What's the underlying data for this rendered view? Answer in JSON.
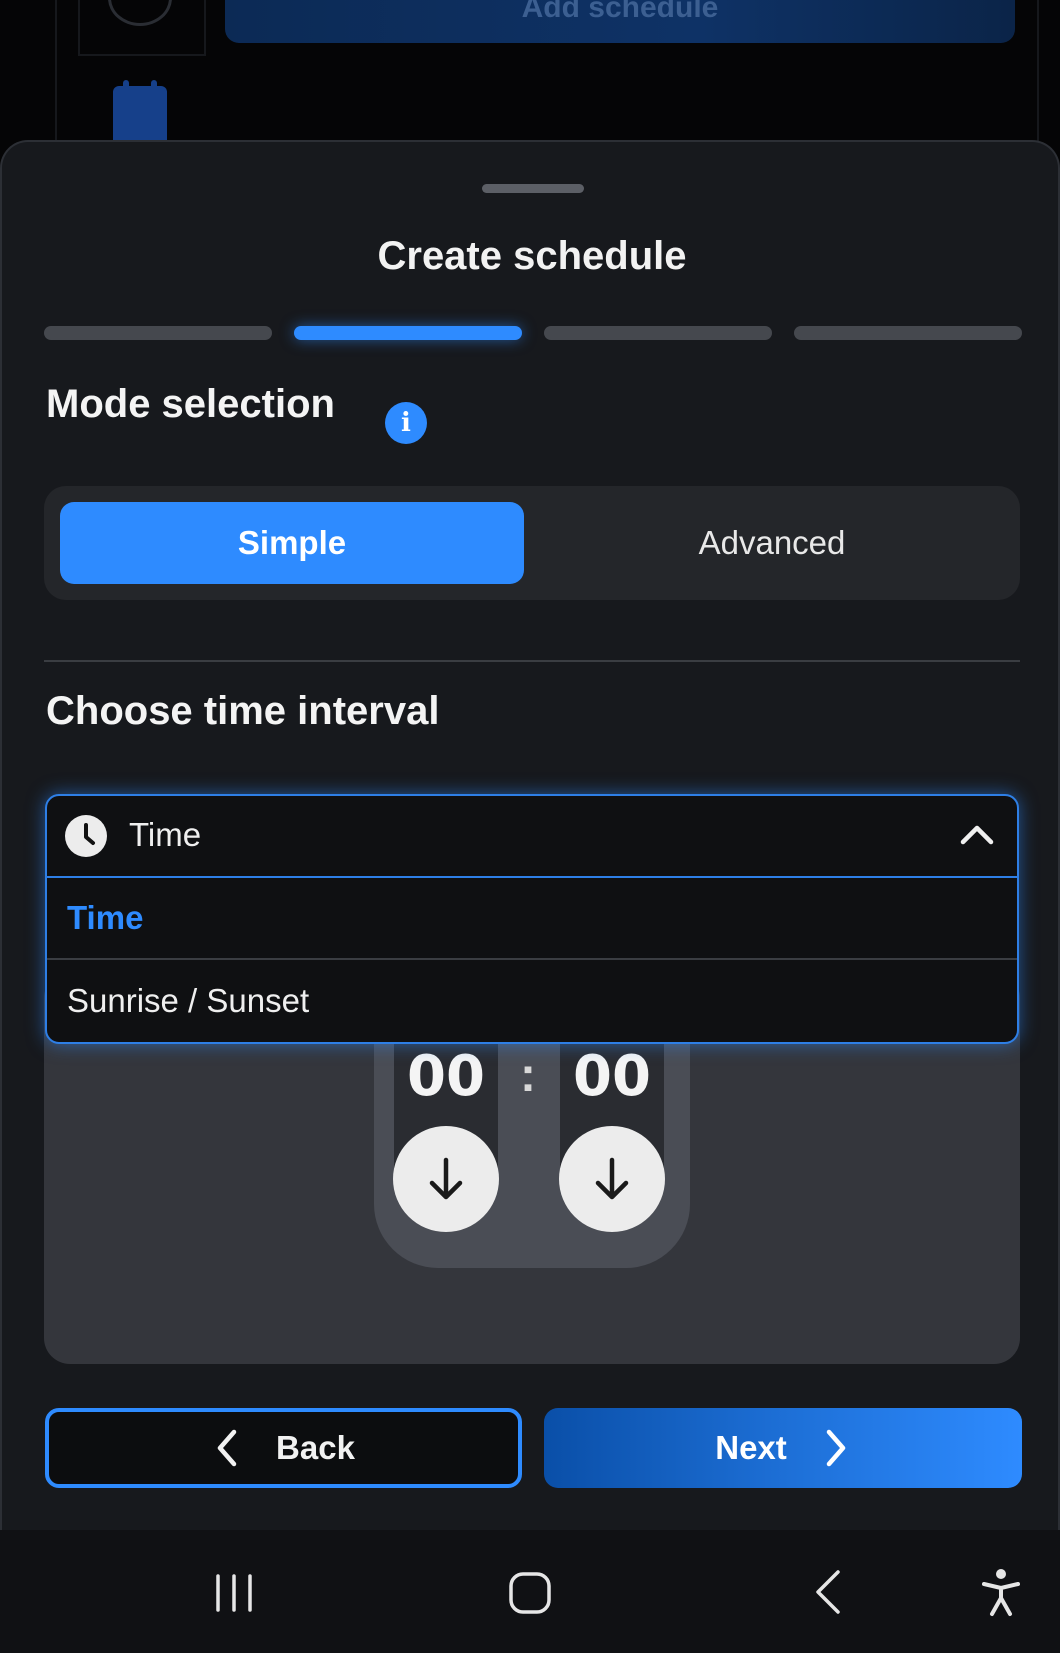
{
  "background": {
    "add_schedule_label": "Add schedule"
  },
  "sheet": {
    "title": "Create schedule",
    "steps": [
      {
        "active": false
      },
      {
        "active": true
      },
      {
        "active": false
      },
      {
        "active": false
      }
    ],
    "mode_selection": {
      "title": "Mode selection",
      "info_icon": "info-icon",
      "options": [
        "Simple",
        "Advanced"
      ],
      "selected": "Simple"
    },
    "interval": {
      "title": "Choose time interval",
      "selected_value": "Time",
      "options": [
        "Time",
        "Sunrise / Sunset"
      ]
    },
    "time_picker": {
      "hours": "00",
      "separator": ":",
      "minutes": "00"
    },
    "buttons": {
      "back_label": "Back",
      "next_label": "Next"
    }
  },
  "colors": {
    "accent": "#2e8bff",
    "sheet_bg": "#17191d",
    "panel_bg": "#34363c"
  }
}
